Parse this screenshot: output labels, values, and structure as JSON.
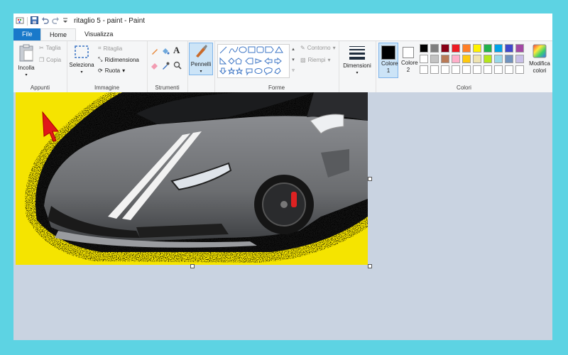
{
  "window": {
    "title": "ritaglio 5 - paint - Paint"
  },
  "tabs": [
    {
      "label": "File"
    },
    {
      "label": "Home"
    },
    {
      "label": "Visualizza"
    }
  ],
  "groups": {
    "appunti": {
      "label": "Appunti",
      "incolla": "Incolla",
      "taglia": "Taglia",
      "copia": "Copia"
    },
    "immagine": {
      "label": "Immagine",
      "seleziona": "Seleziona",
      "ritaglia": "Ritaglia",
      "ridimensiona": "Ridimensiona",
      "ruota": "Ruota"
    },
    "strumenti": {
      "label": "Strumenti"
    },
    "pennelli": {
      "label": "Pennelli"
    },
    "forme": {
      "label": "Forme",
      "contorno": "Contorno",
      "riempi": "Riempi"
    },
    "dimensioni": {
      "label": "Dimensioni"
    },
    "colori": {
      "label": "Colori",
      "colore1": "Colore 1",
      "colore2": "Colore 2",
      "modifica": "Modifica colori",
      "primary": "#000000",
      "secondary": "#ffffff",
      "palette_row1": [
        "#000000",
        "#7f7f7f",
        "#880015",
        "#ed1c24",
        "#ff7f27",
        "#fff200",
        "#22b14c",
        "#00a2e8",
        "#3f48cc",
        "#a349a4"
      ],
      "palette_row2": [
        "#ffffff",
        "#c3c3c3",
        "#b97a57",
        "#ffaec9",
        "#ffc90e",
        "#efe4b0",
        "#b5e61d",
        "#99d9ea",
        "#7092be",
        "#c8bfe7"
      ]
    }
  },
  "canvas": {
    "background_color": "#f5e400",
    "car_color": "#6b6d70"
  },
  "icons": {
    "save": "save-icon",
    "undo": "undo-icon",
    "redo": "redo-icon"
  }
}
